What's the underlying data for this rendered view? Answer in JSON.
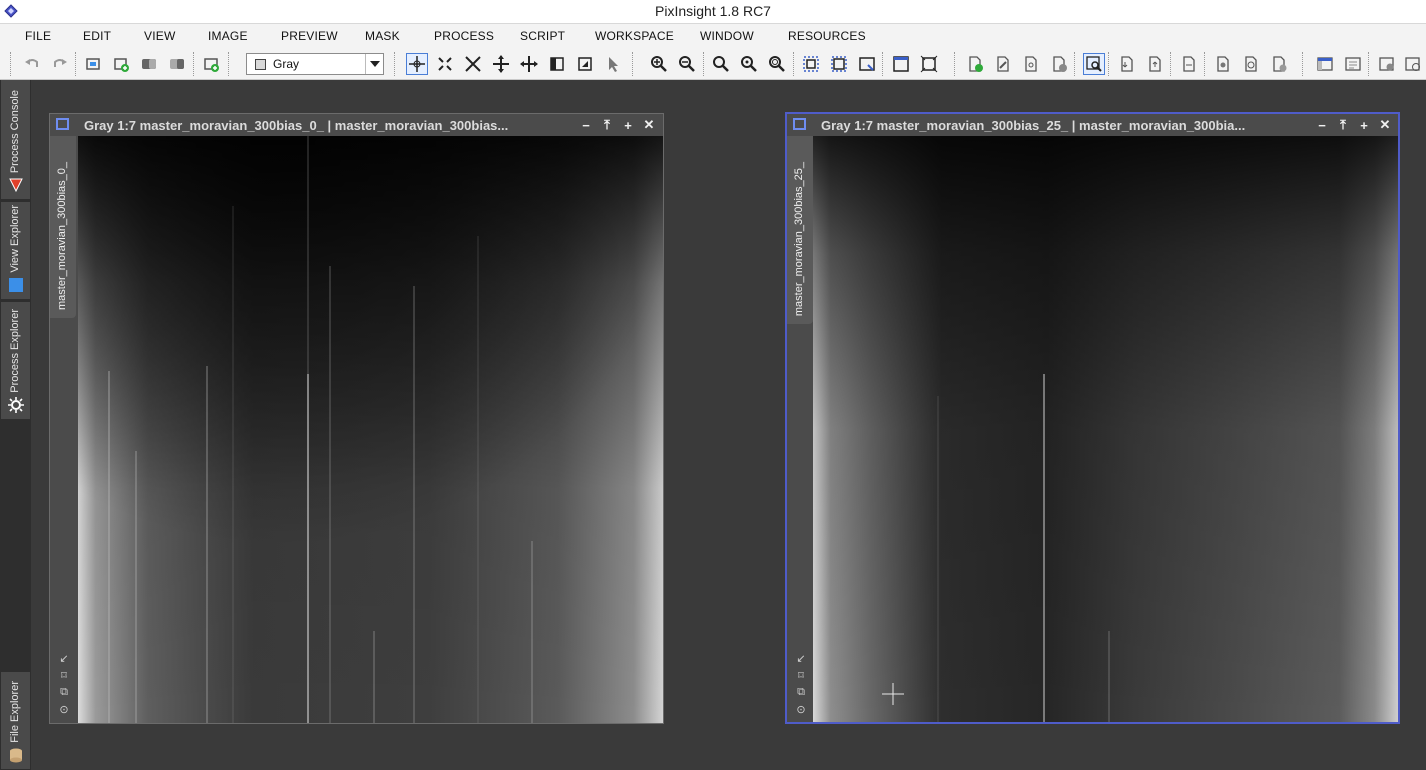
{
  "app": {
    "title": "PixInsight 1.8 RC7"
  },
  "menu": {
    "items": [
      "FILE",
      "EDIT",
      "VIEW",
      "IMAGE",
      "PREVIEW",
      "MASK",
      "PROCESS",
      "SCRIPT",
      "WORKSPACE",
      "WINDOW",
      "RESOURCES"
    ]
  },
  "toolbar": {
    "channel_combo": {
      "selected": "Gray"
    },
    "icons": [
      "undo-icon",
      "redo-icon",
      "new-image-icon",
      "add-image-icon",
      "mask-icon",
      "mask-invert-icon",
      "new-preview-icon",
      "readout-cross-icon",
      "fit-icon",
      "zoom-extents-icon",
      "pan-icon",
      "move-icon",
      "crop-icon",
      "select-icon",
      "pointer-icon",
      "zoom-in-icon",
      "zoom-out-icon",
      "zoom-1-icon",
      "zoom-2-icon",
      "zoom-3-icon",
      "preview-select-icon",
      "preview-edit-icon",
      "preview-store-icon",
      "window-fit-icon",
      "window-max-icon",
      "doc-add-icon",
      "doc-edit-icon",
      "doc-link-icon",
      "doc-remove-icon",
      "magnifier-active-icon",
      "stf-icon",
      "stf-auto-icon",
      "stf-reset-icon",
      "track-icon",
      "undo-history-icon",
      "redo-history-icon",
      "workspace-icon",
      "script-icon",
      "settings-icon",
      "misc-icon"
    ]
  },
  "sidebar": {
    "tabs": [
      {
        "label": "Process Console",
        "icon": "process-console-icon"
      },
      {
        "label": "View Explorer",
        "icon": "view-explorer-icon"
      },
      {
        "label": "Process Explorer",
        "icon": "gear-icon"
      },
      {
        "label": "File Explorer",
        "icon": "file-explorer-icon"
      }
    ]
  },
  "windows": [
    {
      "title": "Gray 1:7 master_moravian_300bias_0_ | master_moravian_300bias...",
      "view_tab": "master_moravian_300bias_0_",
      "active": false,
      "controls": [
        "↙",
        "⌑",
        "⧉",
        "⊙"
      ]
    },
    {
      "title": "Gray 1:7 master_moravian_300bias_25_ | master_moravian_300bia...",
      "view_tab": "master_moravian_300bias_25_",
      "active": true,
      "controls": [
        "↙",
        "⌑",
        "⧉",
        "⊙"
      ]
    }
  ],
  "window_buttons": [
    "−",
    "⤒",
    "+",
    "✕"
  ],
  "colors": {
    "workspace_bg": "#3a3a3a",
    "window_bg": "#4b4b4b",
    "active_border": "#4f5cc9",
    "accent_red": "#e0402a",
    "accent_blue": "#3b8fe8"
  }
}
